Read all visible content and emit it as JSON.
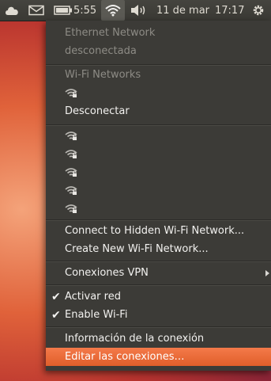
{
  "panel": {
    "battery_time": "5:55",
    "date": "11 de mar",
    "time": "17:17",
    "icons": [
      "cloud-icon",
      "mail-icon",
      "battery-icon",
      "wifi-icon",
      "volume-icon",
      "gear-icon"
    ]
  },
  "menu": {
    "ethernet_header": "Ethernet Network",
    "ethernet_status": "desconectada",
    "wifi_header": "Wi-Fi Networks",
    "disconnect": "Desconectar",
    "connect_hidden": "Connect to Hidden Wi-Fi Network...",
    "create_new": "Create New Wi-Fi Network...",
    "vpn": "Conexiones VPN",
    "enable_network": "Activar red",
    "enable_wifi": "Enable Wi-Fi",
    "connection_info": "Información de la conexión",
    "edit_connections": "Editar las conexiones…"
  },
  "colors": {
    "panel": "#3a3934",
    "menu": "#3c3b37",
    "highlight": "#e8672f"
  }
}
